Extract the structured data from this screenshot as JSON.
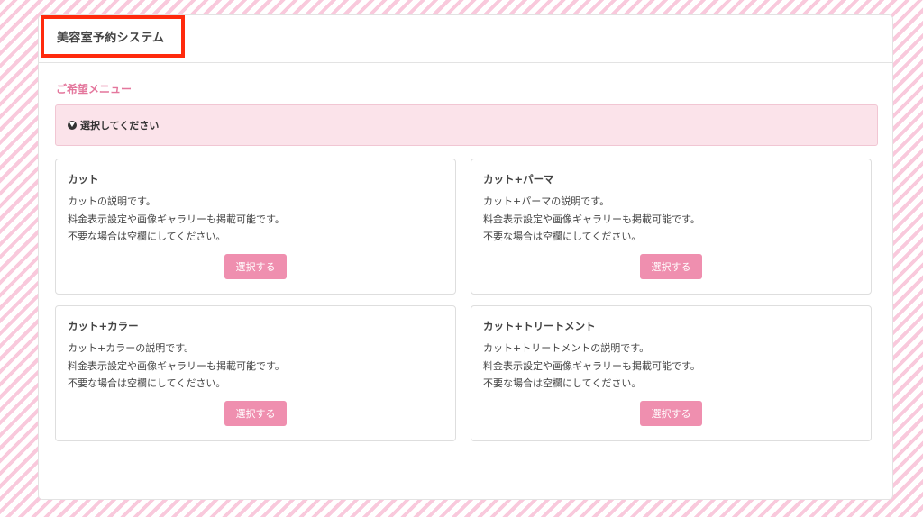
{
  "header": {
    "title": "美容室予約システム"
  },
  "menu": {
    "label": "ご希望メニュー",
    "select_prompt": "選択してください",
    "items": [
      {
        "title": "カット",
        "desc": [
          "カットの説明です。",
          "料金表示設定や画像ギャラリーも掲載可能です。",
          "不要な場合は空欄にしてください。"
        ],
        "button": "選択する"
      },
      {
        "title": "カット+パーマ",
        "desc": [
          "カット+パーマの説明です。",
          "料金表示設定や画像ギャラリーも掲載可能です。",
          "不要な場合は空欄にしてください。"
        ],
        "button": "選択する"
      },
      {
        "title": "カット+カラー",
        "desc": [
          "カット+カラーの説明です。",
          "料金表示設定や画像ギャラリーも掲載可能です。",
          "不要な場合は空欄にしてください。"
        ],
        "button": "選択する"
      },
      {
        "title": "カット+トリートメント",
        "desc": [
          "カット+トリートメントの説明です。",
          "料金表示設定や画像ギャラリーも掲載可能です。",
          "不要な場合は空欄にしてください。"
        ],
        "button": "選択する"
      }
    ]
  },
  "colors": {
    "accent": "#e4779d",
    "button": "#ef8faf",
    "highlight_border": "#ff2a0d",
    "select_bg": "#fbe3ea"
  }
}
